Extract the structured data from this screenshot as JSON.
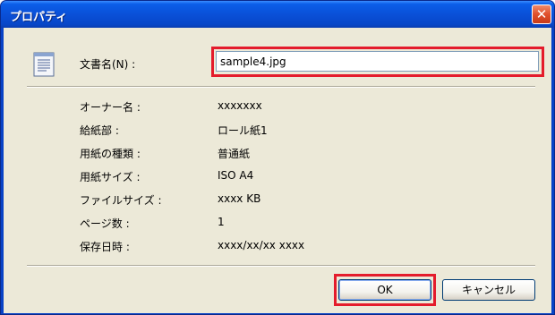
{
  "window": {
    "title": "プロパティ",
    "close_glyph": "✕"
  },
  "document_name": {
    "label": "文書名(N) :",
    "value": "sample4.jpg"
  },
  "properties": [
    {
      "label": "オーナー名 :",
      "value": "xxxxxxx"
    },
    {
      "label": "給紙部 :",
      "value": "ロール紙1"
    },
    {
      "label": "用紙の種類 :",
      "value": "普通紙"
    },
    {
      "label": "用紙サイズ :",
      "value": "ISO A4"
    },
    {
      "label": "ファイルサイズ :",
      "value": "xxxx KB"
    },
    {
      "label": "ページ数 :",
      "value": "1"
    },
    {
      "label": "保存日時 :",
      "value": "xxxx/xx/xx xxxx"
    }
  ],
  "buttons": {
    "ok_label": "OK",
    "cancel_label": "キャンセル"
  },
  "icons": {
    "document": "document-icon",
    "close": "close-icon"
  },
  "colors": {
    "titlebar": "#0842c6",
    "highlight": "#e41c2c",
    "dialog_bg": "#ece9d8"
  }
}
